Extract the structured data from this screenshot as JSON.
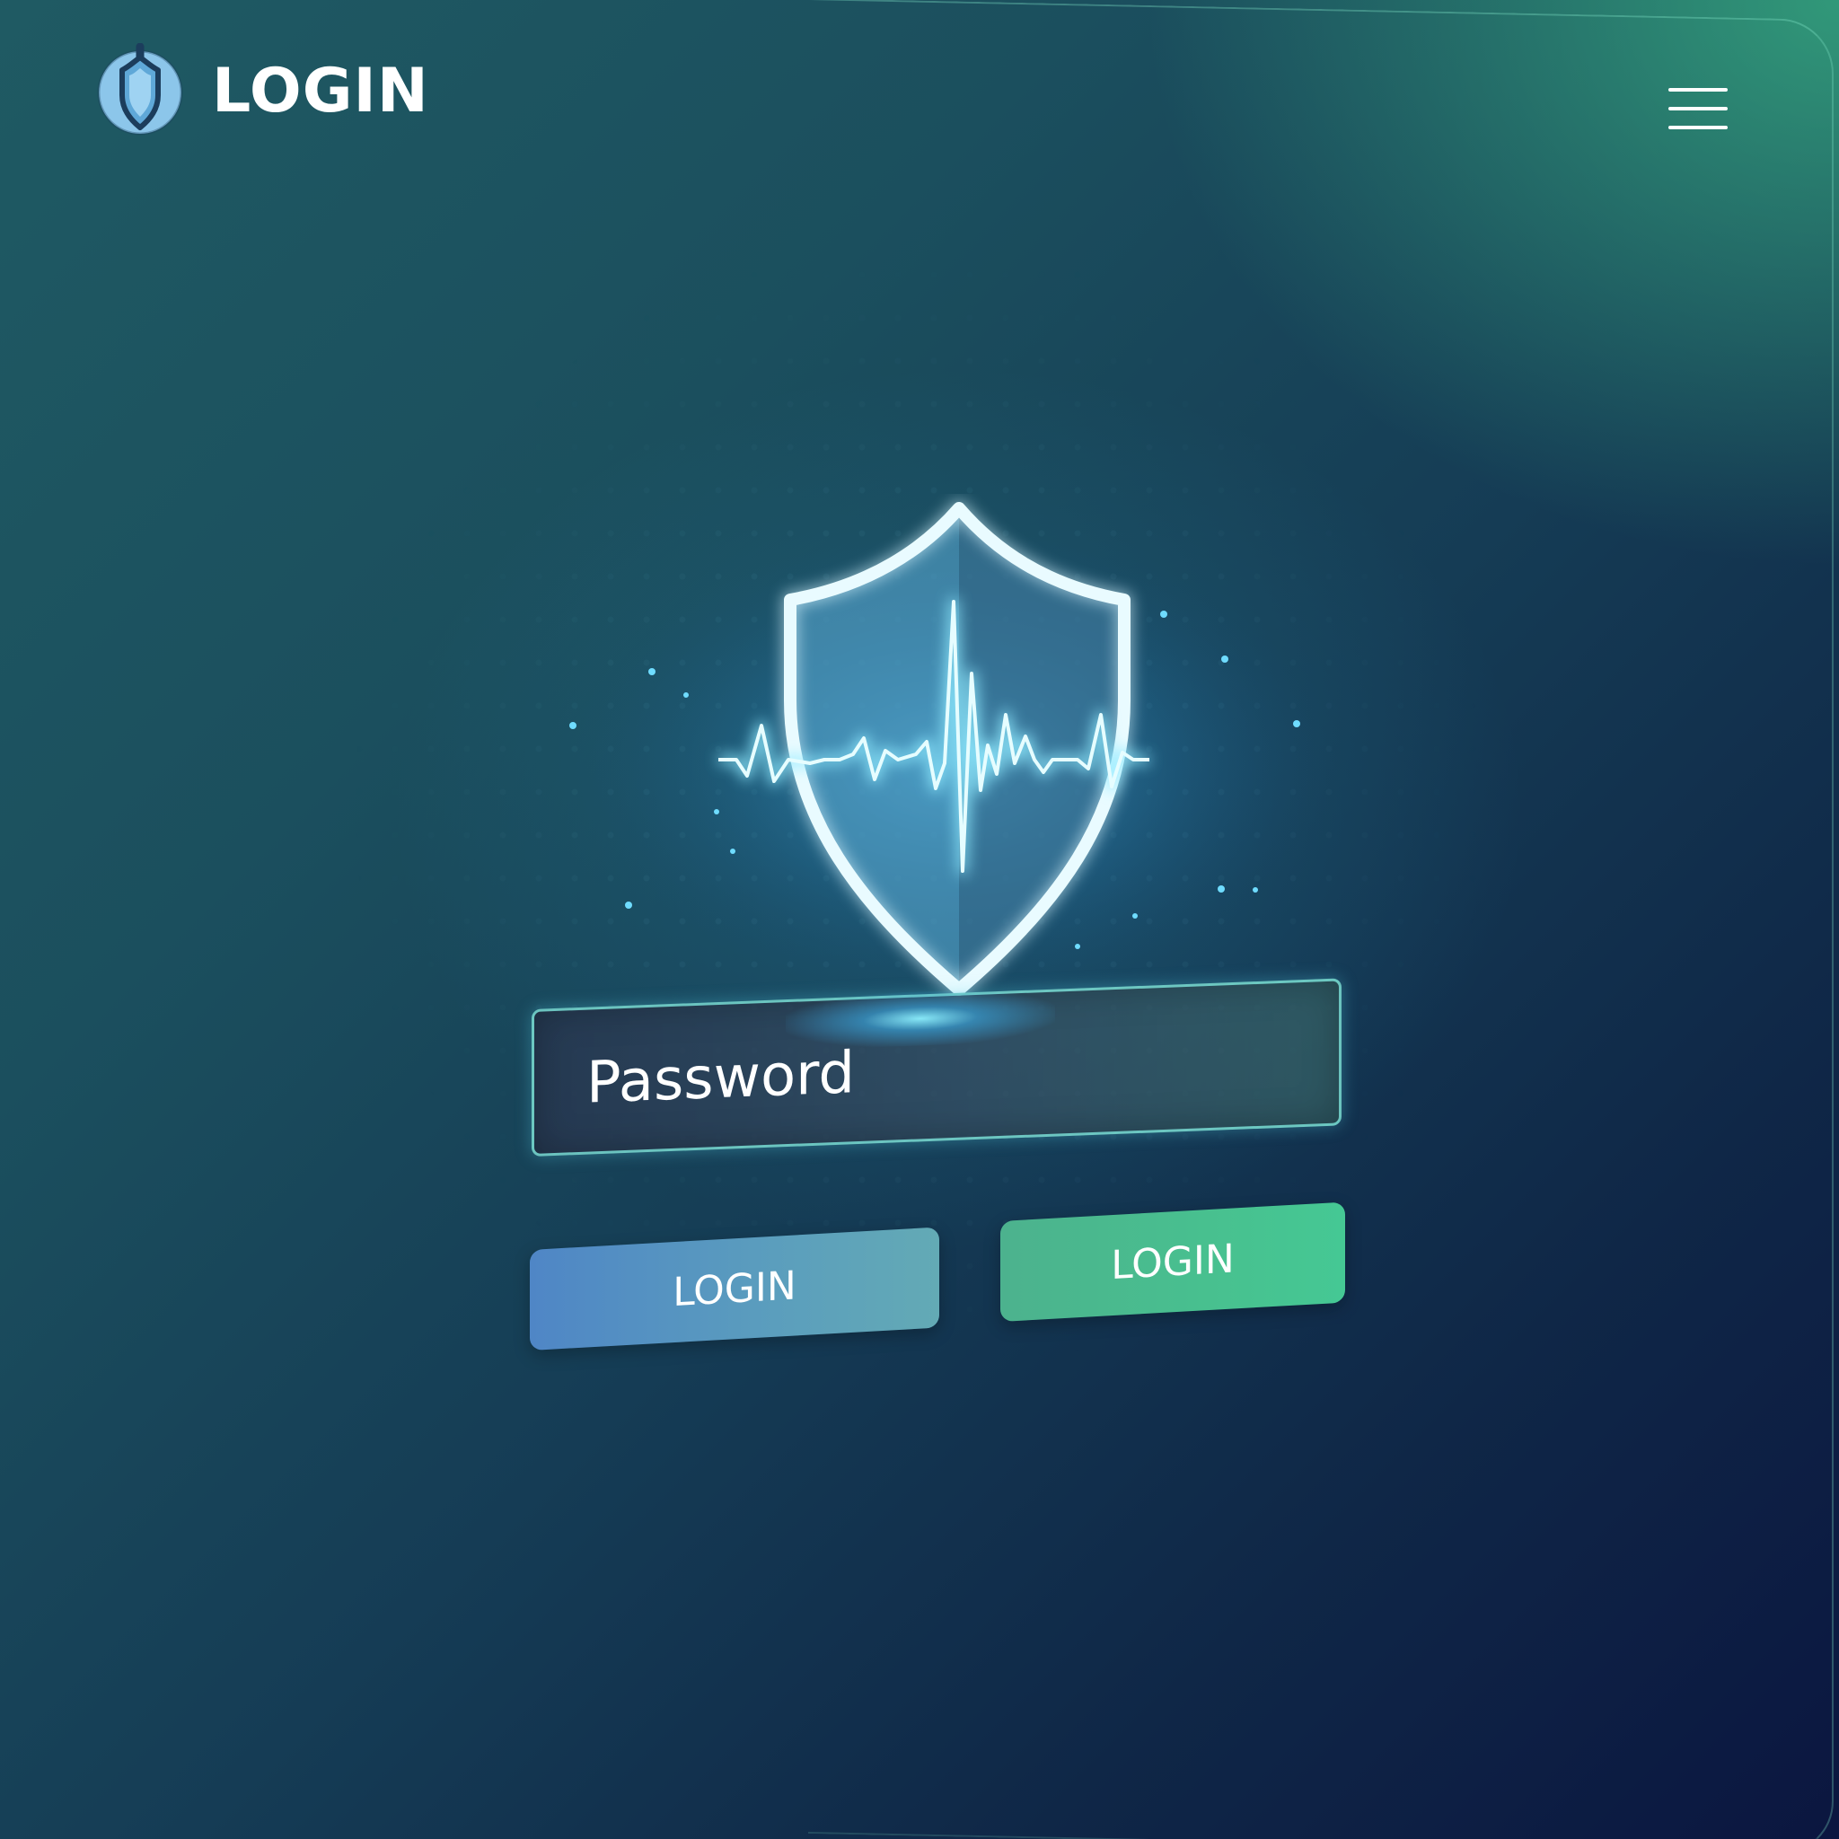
{
  "header": {
    "logo_icon": "shield-icon",
    "title": "LOGIN"
  },
  "menu": {
    "icon": "hamburger-menu-icon"
  },
  "hero": {
    "icon": "shield-pulse-icon"
  },
  "form": {
    "password_placeholder": "Password",
    "login_button_left_label": "LOGIN",
    "login_button_right_label": "LOGIN"
  },
  "colors": {
    "accent_blue": "#5b9ebd",
    "accent_green": "#48c08f",
    "glow_cyan": "#7ee8ff",
    "text": "#ffffff"
  }
}
